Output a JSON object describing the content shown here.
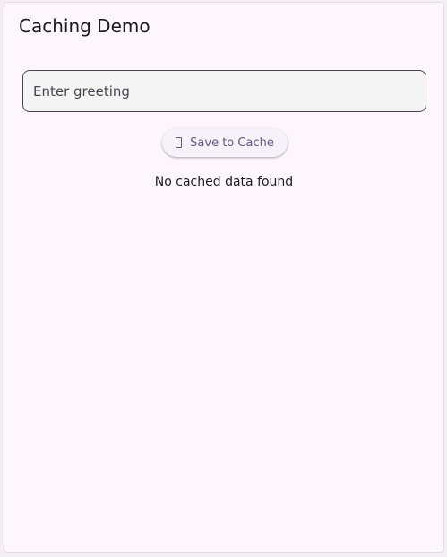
{
  "app_bar": {
    "title": "Caching Demo"
  },
  "greeting_input": {
    "placeholder": "Enter greeting",
    "value": ""
  },
  "save_button": {
    "label": "Save to Cache",
    "icon": "save-icon"
  },
  "status": {
    "text": "No cached data found"
  },
  "colors": {
    "background": "#fdf7fd",
    "accent": "#65558f",
    "text": "#1d1b20"
  }
}
